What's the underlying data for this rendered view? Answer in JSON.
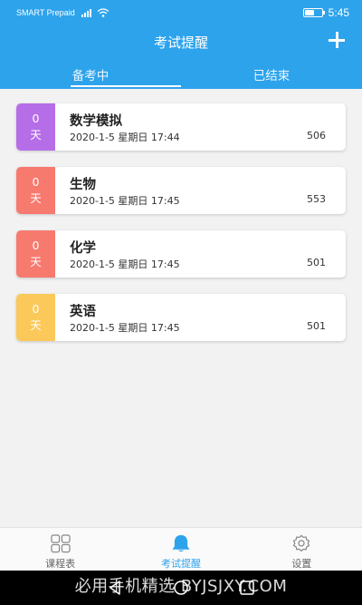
{
  "status_bar": {
    "carrier": "SMART Prepaid",
    "time": "5:45"
  },
  "header": {
    "title": "考试提醒",
    "tabs": [
      {
        "label": "备考中"
      },
      {
        "label": "已结束"
      }
    ]
  },
  "exams": [
    {
      "days_value": "0",
      "days_unit": "天",
      "name": "数学模拟",
      "datetime": "2020-1-5 星期日 17:44",
      "room": "506",
      "color": "#b66de8"
    },
    {
      "days_value": "0",
      "days_unit": "天",
      "name": "生物",
      "datetime": "2020-1-5 星期日 17:45",
      "room": "553",
      "color": "#f77a6f"
    },
    {
      "days_value": "0",
      "days_unit": "天",
      "name": "化学",
      "datetime": "2020-1-5 星期日 17:45",
      "room": "501",
      "color": "#f77a6f"
    },
    {
      "days_value": "0",
      "days_unit": "天",
      "name": "英语",
      "datetime": "2020-1-5 星期日 17:45",
      "room": "501",
      "color": "#fbc85a"
    }
  ],
  "bottom_nav": {
    "items": [
      {
        "label": "课程表",
        "icon": "grid-icon"
      },
      {
        "label": "考试提醒",
        "icon": "bell-icon"
      },
      {
        "label": "设置",
        "icon": "gear-icon"
      }
    ]
  },
  "watermark": "必用手机精选 BYJSJXY.COM",
  "colors": {
    "primary": "#2da3ec"
  }
}
